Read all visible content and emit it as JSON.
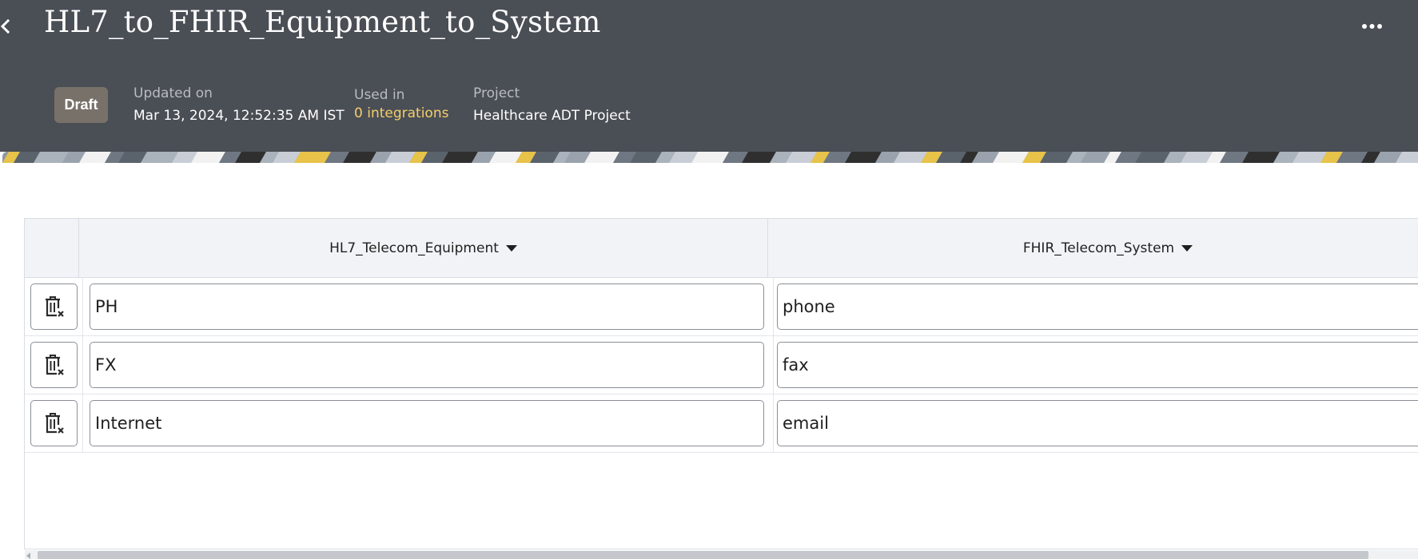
{
  "header": {
    "title": "HL7_to_FHIR_Equipment_to_System",
    "back_icon": "chevron-left-icon",
    "more_icon": "more-horizontal-icon",
    "status": "Draft",
    "updated_label": "Updated on",
    "updated_value": "Mar 13, 2024, 12:52:35 AM IST",
    "used_in_label": "Used in",
    "used_in_value": "0 integrations",
    "project_label": "Project",
    "project_value": "Healthcare ADT Project"
  },
  "colors": {
    "header_bg": "#4a4e55",
    "status_badge_bg": "#78716a",
    "link": "#f4cf6a",
    "table_header_bg": "#f1f3f7"
  },
  "table": {
    "columns": [
      {
        "label": "HL7_Telecom_Equipment"
      },
      {
        "label": "FHIR_Telecom_System"
      }
    ],
    "delete_icon": "trash-delete-icon",
    "rows": [
      {
        "hl7": "PH",
        "fhir": "phone"
      },
      {
        "hl7": "FX",
        "fhir": "fax"
      },
      {
        "hl7": "Internet",
        "fhir": "email"
      }
    ]
  }
}
